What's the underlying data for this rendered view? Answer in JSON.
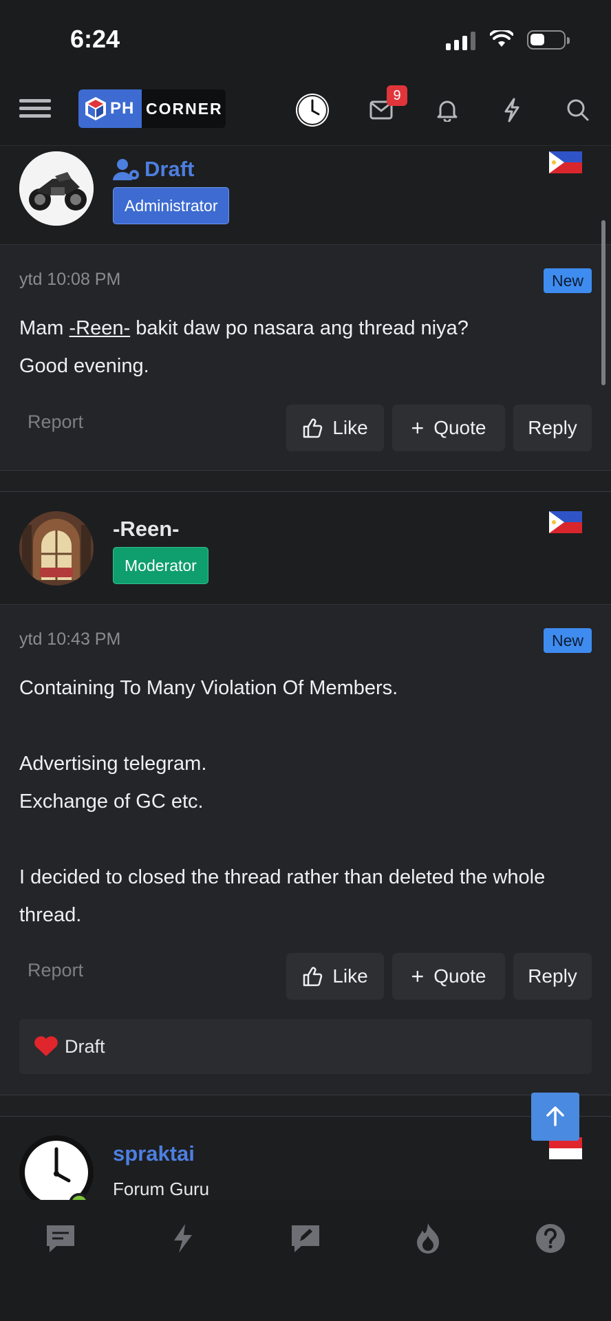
{
  "status_bar": {
    "time": "6:24"
  },
  "header": {
    "logo_part1": "PH",
    "logo_part2": "CORNER",
    "inbox_count": "9"
  },
  "posts": [
    {
      "username": "Draft",
      "role": "Administrator",
      "role_color": "#3d6bd1",
      "timestamp": "ytd 10:08 PM",
      "new_label": "New",
      "message_prefix": "Mam ",
      "mention": "-Reen-",
      "message_suffix": " bakit daw po nasara ang thread niya?\nGood evening.",
      "report_label": "Report",
      "like_label": "Like",
      "quote_label": "Quote",
      "reply_label": "Reply"
    },
    {
      "username": "-Reen-",
      "role": "Moderator",
      "role_color": "#0f9e6e",
      "timestamp": "ytd 10:43 PM",
      "new_label": "New",
      "message": "Containing To Many Violation Of Members.\n\nAdvertising telegram.\nExchange of GC etc.\n\nI decided to closed the thread rather than deleted the whole thread.",
      "report_label": "Report",
      "like_label": "Like",
      "quote_label": "Quote",
      "reply_label": "Reply",
      "reaction_user": "Draft"
    },
    {
      "username": "spraktai",
      "role": "Forum Guru"
    }
  ],
  "colors": {
    "accent": "#4a8ae0",
    "background": "#1f2022",
    "new_tag": "#3f8cf0"
  }
}
